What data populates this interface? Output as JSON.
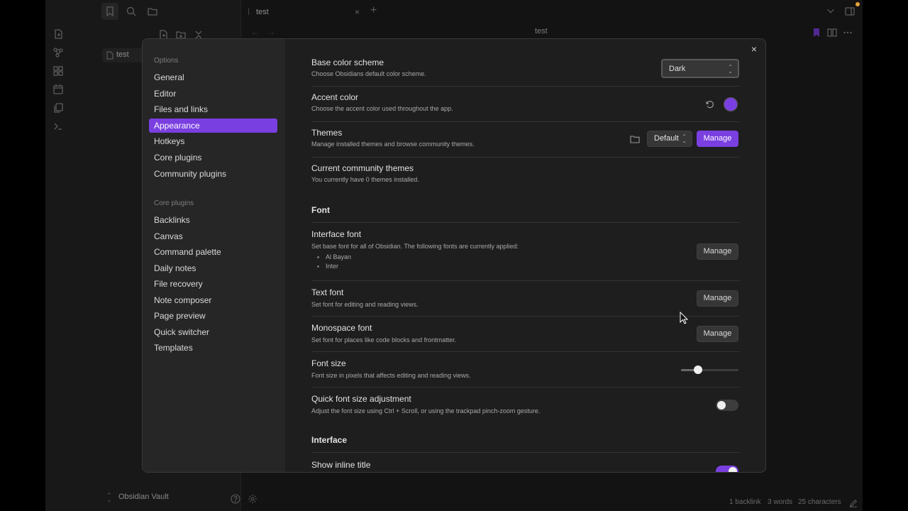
{
  "sidebar": {
    "file_name": "test",
    "vault_name": "Obsidian Vault"
  },
  "tabs": {
    "active_title": "test",
    "close": "×",
    "new": "+"
  },
  "document": {
    "title": "test",
    "back": "←",
    "forward": "→"
  },
  "status_bar": {
    "backlinks": "1 backlink",
    "words": "3 words",
    "characters": "25 characters"
  },
  "settings": {
    "close": "×",
    "options_heading": "Options",
    "options": [
      "General",
      "Editor",
      "Files and links",
      "Appearance",
      "Hotkeys",
      "Core plugins",
      "Community plugins"
    ],
    "active_option": "Appearance",
    "core_plugins_heading": "Core plugins",
    "core_plugins": [
      "Backlinks",
      "Canvas",
      "Command palette",
      "Daily notes",
      "File recovery",
      "Note composer",
      "Page preview",
      "Quick switcher",
      "Templates"
    ],
    "base_color_scheme": {
      "name": "Base color scheme",
      "desc": "Choose Obsidians default color scheme.",
      "value": "Dark"
    },
    "accent_color": {
      "name": "Accent color",
      "desc": "Choose the accent color used throughout the app.",
      "color": "#7a3fe0"
    },
    "themes": {
      "name": "Themes",
      "desc": "Manage installed themes and browse community themes.",
      "value": "Default",
      "button": "Manage"
    },
    "community_themes": {
      "name": "Current community themes",
      "desc": "You currently have 0 themes installed."
    },
    "font_section": "Font",
    "interface_font": {
      "name": "Interface font",
      "desc": "Set base font for all of Obsidian. The following fonts are currently applied:",
      "fonts": [
        "Al Bayan",
        "Inter"
      ],
      "button": "Manage"
    },
    "text_font": {
      "name": "Text font",
      "desc": "Set font for editing and reading views.",
      "button": "Manage"
    },
    "monospace_font": {
      "name": "Monospace font",
      "desc": "Set font for places like code blocks and frontmatter.",
      "button": "Manage"
    },
    "font_size": {
      "name": "Font size",
      "desc": "Font size in pixels that affects editing and reading views.",
      "slider_fraction": 0.3
    },
    "quick_font_size": {
      "name": "Quick font size adjustment",
      "desc": "Adjust the font size using Ctrl + Scroll, or using the trackpad pinch-zoom gesture.",
      "enabled": false
    },
    "interface_section": "Interface",
    "inline_title": {
      "name": "Show inline title",
      "enabled": true
    }
  }
}
